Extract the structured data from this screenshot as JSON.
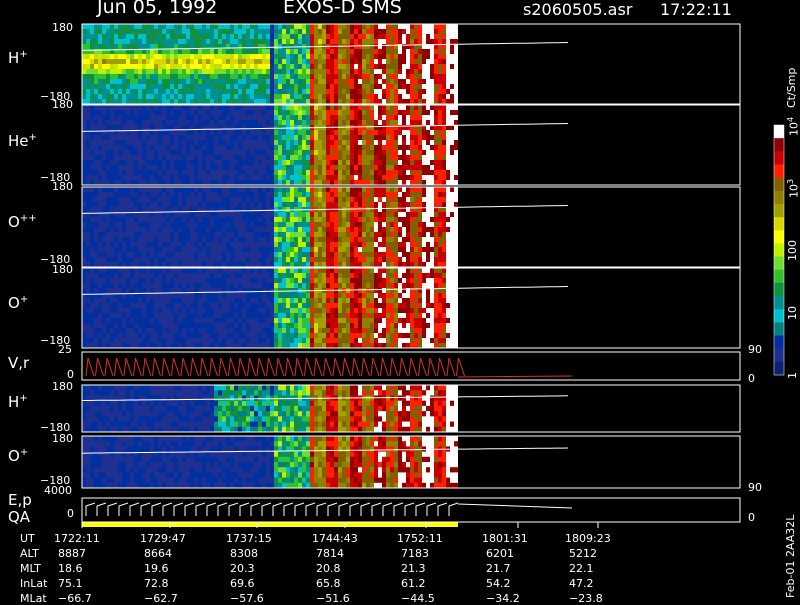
{
  "header": {
    "date": "Jun 05, 1992",
    "mission": "EXOS-D SMS",
    "file": "s2060505.asr",
    "time": "17:22:11"
  },
  "panels": [
    {
      "species": "H",
      "charge": "+",
      "ymax": "180",
      "ymin": "−180"
    },
    {
      "species": "He",
      "charge": "+",
      "ymax": "180",
      "ymin": "−180"
    },
    {
      "species": "O",
      "charge": "++",
      "ymax": "180",
      "ymin": "−180"
    },
    {
      "species": "O",
      "charge": "+",
      "ymax": "180",
      "ymin": "−180"
    },
    {
      "species": "V,r",
      "charge": "",
      "ymax": "25",
      "ymin": "0",
      "rmax": "90",
      "rmin": "0"
    },
    {
      "species": "H",
      "charge": "+",
      "ymax": "180",
      "ymin": "−180"
    },
    {
      "species": "O",
      "charge": "+",
      "ymax": "180",
      "ymin": "−180"
    },
    {
      "species": "E,p",
      "charge": "",
      "ymax": "4000",
      "ymin": "0",
      "rmax": "90",
      "rmin": "0"
    }
  ],
  "qa_label": "QA",
  "colorbar": {
    "unit": "Ct/Smp",
    "labels": [
      {
        "base": "10",
        "exp": "4",
        "v": 10000
      },
      {
        "base": "10",
        "exp": "3",
        "v": 1000
      },
      {
        "base": "100",
        "exp": "",
        "v": 100
      },
      {
        "base": "10",
        "exp": "",
        "v": 10
      },
      {
        "base": "1",
        "exp": "",
        "v": 1
      }
    ],
    "colors": [
      "#ffffff",
      "#900000",
      "#c80000",
      "#ff2000",
      "#806000",
      "#908000",
      "#a0a000",
      "#d8d800",
      "#ffff00",
      "#c0f000",
      "#70e030",
      "#30c030",
      "#109040",
      "#009090",
      "#00c0d0",
      "#008080",
      "#0030a0",
      "#203090",
      "#102070"
    ]
  },
  "ephemeris": {
    "labels": [
      "UT",
      "ALT",
      "MLT",
      "InLat",
      "MLat"
    ],
    "columns": [
      {
        "UT": "1722:11",
        "ALT": "8887",
        "MLT": "18.6",
        "InLat": "75.1",
        "MLat": "−66.7"
      },
      {
        "UT": "1729:47",
        "ALT": "8664",
        "MLT": "19.6",
        "InLat": "72.8",
        "MLat": "−62.7"
      },
      {
        "UT": "1737:15",
        "ALT": "8308",
        "MLT": "20.3",
        "InLat": "69.6",
        "MLat": "−57.6"
      },
      {
        "UT": "1744:43",
        "ALT": "7814",
        "MLT": "20.8",
        "InLat": "65.8",
        "MLat": "−51.6"
      },
      {
        "UT": "1752:11",
        "ALT": "7183",
        "MLT": "21.3",
        "InLat": "61.2",
        "MLat": "−44.5"
      },
      {
        "UT": "1801:31",
        "ALT": "6201",
        "MLT": "21.7",
        "InLat": "54.2",
        "MLat": "−34.2"
      },
      {
        "UT": "1809:23",
        "ALT": "5212",
        "MLT": "22.1",
        "InLat": "47.2",
        "MLat": "−23.8"
      }
    ]
  },
  "footer_id": "Feb-01 2AA32L",
  "chart_data": {
    "type": "heatmap",
    "title": "Jun 05, 1992  EXOS-D SMS",
    "x_ut_ticks": [
      "1722:11",
      "1729:47",
      "1737:15",
      "1744:43",
      "1752:11",
      "1801:31",
      "1809:23"
    ],
    "panels": [
      "H+",
      "He+",
      "O++",
      "O+",
      "V,r",
      "H+",
      "O+",
      "E,p"
    ],
    "ylim_pitch": [
      -180,
      180
    ],
    "ylim_v": [
      0,
      25
    ],
    "ylim_e": [
      0,
      4000
    ],
    "ylim_right": [
      0,
      90
    ],
    "colorbar_range": [
      1,
      10000
    ],
    "colorbar_scale": "log",
    "colorbar_unit": "Ct/Smp"
  }
}
